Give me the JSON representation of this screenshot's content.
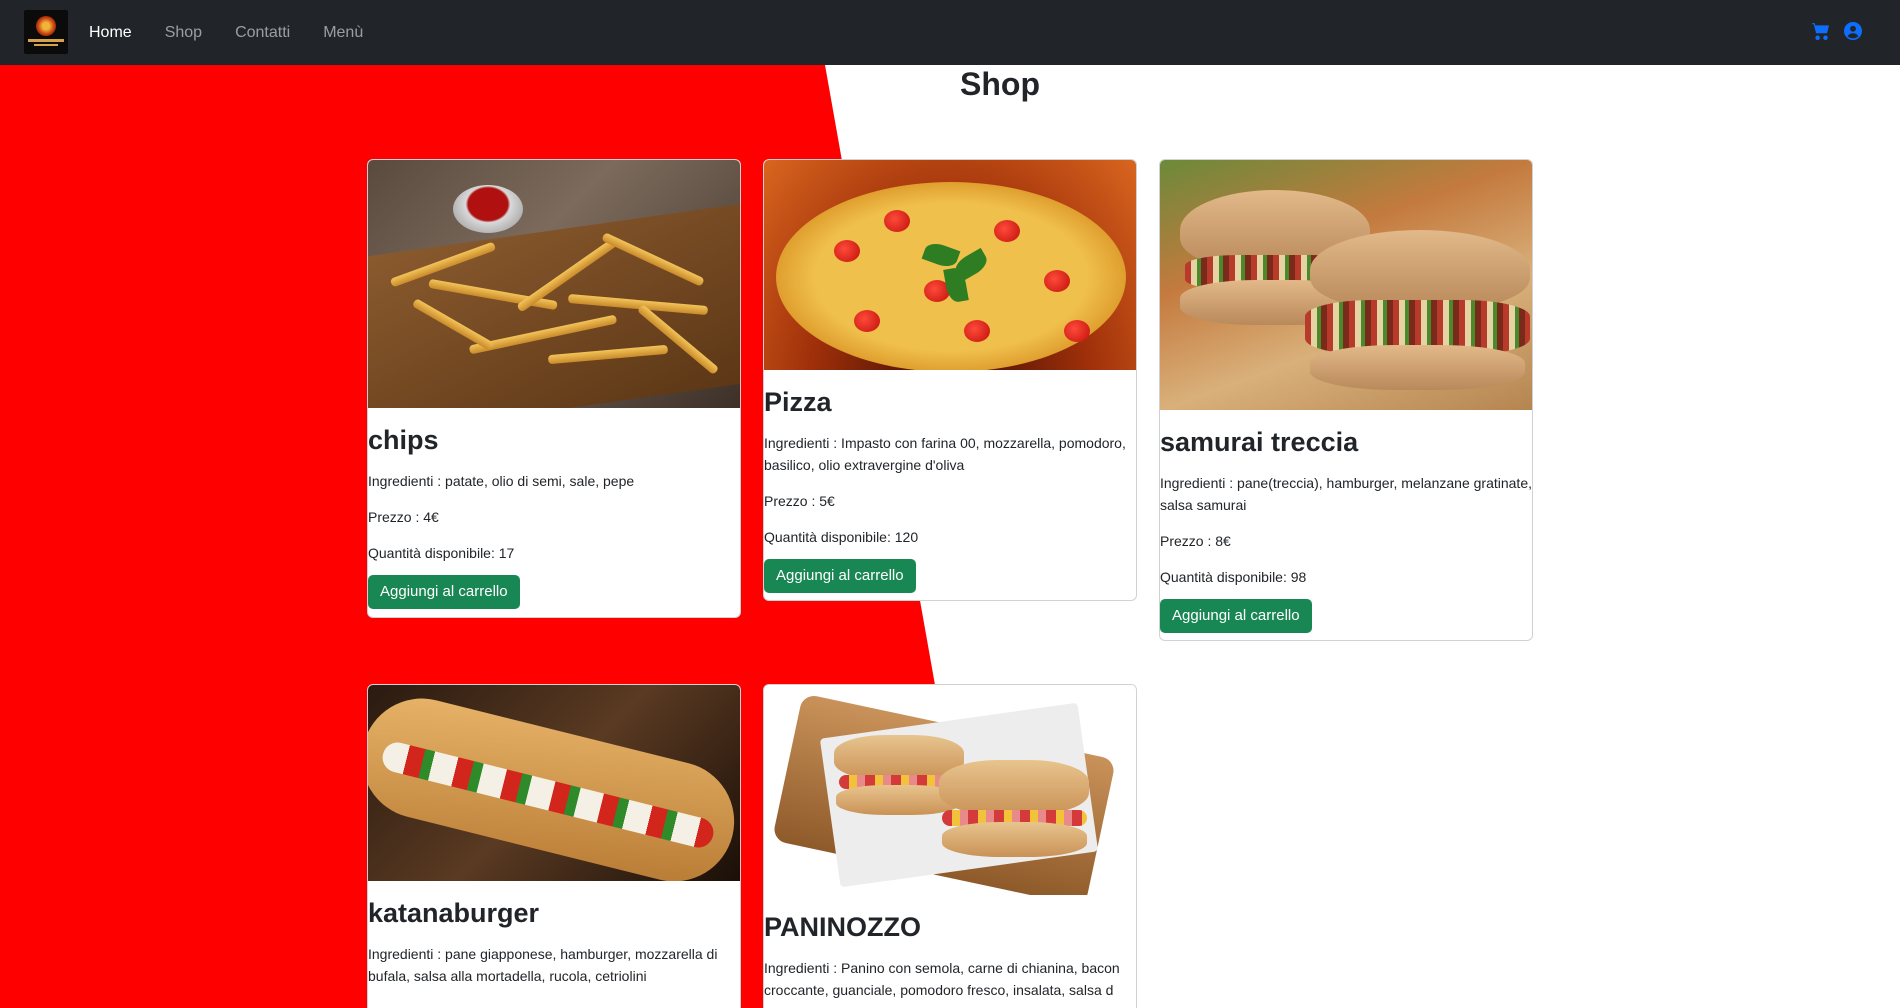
{
  "nav": {
    "links": [
      "Home",
      "Shop",
      "Contatti",
      "Menù"
    ],
    "active": "Home"
  },
  "page": {
    "title": "Shop"
  },
  "colors": {
    "accent_red": "#ff0000",
    "navbar": "#212529",
    "button": "#198754",
    "icon_blue": "#0d6efd"
  },
  "icons": [
    "cart-icon",
    "user-circle-icon"
  ],
  "products": [
    {
      "name": "chips",
      "ingredients": "Ingredienti : patate, olio di semi, sale, pepe",
      "price": "Prezzo : 4€",
      "quantity": "Quantità disponibile: 17",
      "button": "Aggiungi al carrello"
    },
    {
      "name": "Pizza",
      "ingredients": "Ingredienti : Impasto con farina 00, mozzarella, pomodoro, basilico, olio extravergine d'oliva",
      "price": "Prezzo : 5€",
      "quantity": "Quantità disponibile: 120",
      "button": "Aggiungi al carrello"
    },
    {
      "name": "samurai treccia",
      "ingredients": "Ingredienti : pane(treccia), hamburger, melanzane gratinate, salsa samurai",
      "price": "Prezzo : 8€",
      "quantity": "Quantità disponibile: 98",
      "button": "Aggiungi al carrello"
    },
    {
      "name": "katanaburger",
      "ingredients": "Ingredienti : pane giapponese, hamburger, mozzarella di bufala, salsa alla mortadella, rucola, cetriolini"
    },
    {
      "name": "PANINOZZO",
      "ingredients": "Ingredienti : Panino con semola, carne di chianina, bacon croccante, guanciale, pomodoro fresco, insalata, salsa d"
    }
  ]
}
